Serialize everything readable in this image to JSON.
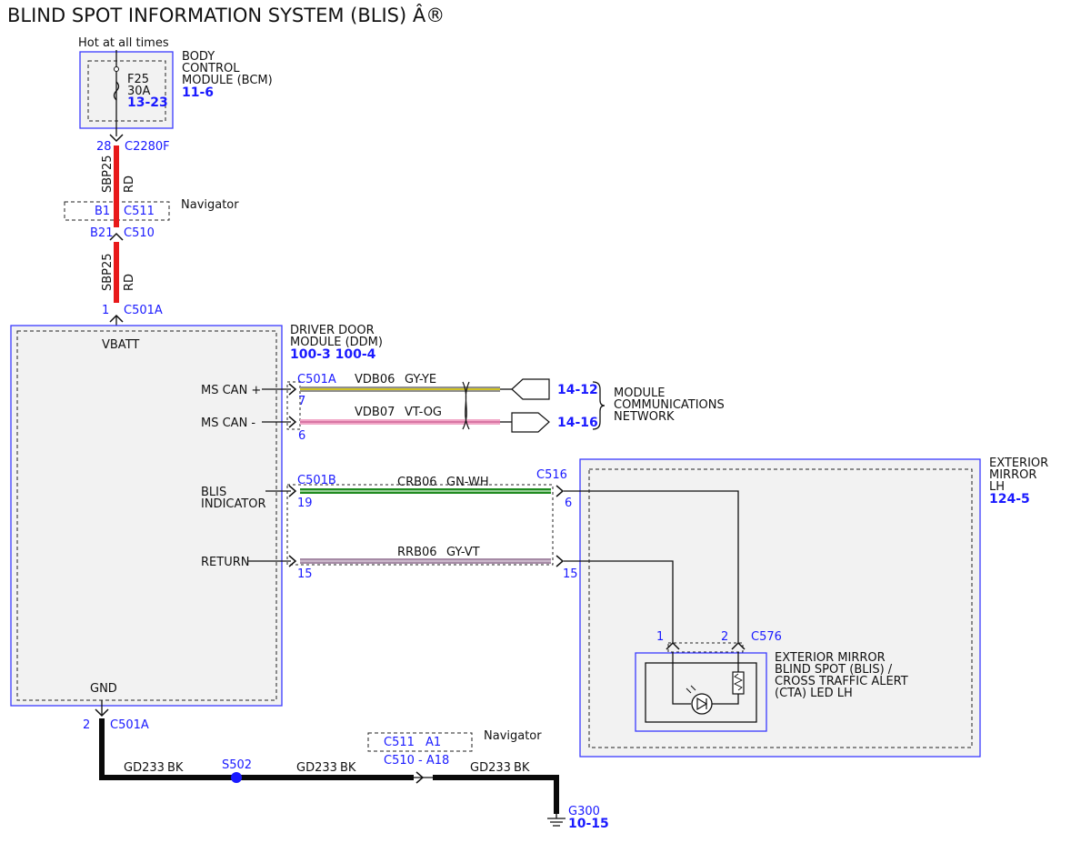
{
  "title": "BLIND SPOT INFORMATION SYSTEM (BLIS) Â®",
  "power": {
    "label": "Hot at all times"
  },
  "bcm": {
    "name_lines": [
      "BODY",
      "CONTROL",
      "MODULE (BCM)"
    ],
    "ref": "11-6",
    "fuse": {
      "id": "F25",
      "rating": "30A",
      "ref": "13-23"
    }
  },
  "conn_c2280f": {
    "pin": "28",
    "id": "C2280F"
  },
  "wire_sbp25": {
    "circuit": "SBP25",
    "color": "RD",
    "hex": "#e8191a"
  },
  "navigator_c511": {
    "left": "B1",
    "right": "C511",
    "label": "Navigator",
    "lower_pin": "B21",
    "lower_conn": "C510"
  },
  "conn_c501a_top": {
    "pin": "1",
    "id": "C501A"
  },
  "ddm": {
    "name_lines": [
      "DRIVER DOOR",
      "MODULE (DDM)"
    ],
    "ref": "100-3 100-4",
    "pins": {
      "vbatt": "VBATT",
      "ms_can_plus": "MS CAN +",
      "ms_can_minus": "MS CAN -",
      "blis_lines": [
        "BLIS",
        "INDICATOR"
      ],
      "return": "RETURN",
      "gnd": "GND"
    }
  },
  "can_plus": {
    "conn": "C501A",
    "pin": "7",
    "circuit": "VDB06",
    "color": "GY-YE",
    "ref": "14-12",
    "hex": "#8f8f8f",
    "stripe": "#e6d300"
  },
  "can_minus": {
    "pin": "6",
    "circuit": "VDB07",
    "color": "VT-OG",
    "ref": "14-16",
    "hex": "#f2a7c7",
    "stripe": "#c85a8f"
  },
  "mcn": {
    "lines": [
      "MODULE",
      "COMMUNICATIONS",
      "NETWORK"
    ]
  },
  "blis_wire": {
    "conn": "C501B",
    "pin": "19",
    "circuit": "CRB06",
    "color": "GN-WH",
    "hex": "#1f8a1f",
    "stripe": "#bfe6bf",
    "mirror_conn": "C516",
    "mirror_pin": "6"
  },
  "return_wire": {
    "pin": "15",
    "circuit": "RRB06",
    "color": "GY-VT",
    "hex": "#a58aa5",
    "stripe": "#d8c6d8",
    "mirror_pin": "15"
  },
  "mirror": {
    "name_lines": [
      "EXTERIOR",
      "MIRROR",
      "LH"
    ],
    "ref": "124-5",
    "c576": {
      "pin1": "1",
      "pin2": "2",
      "id": "C576"
    },
    "led_lines": [
      "EXTERIOR MIRROR",
      "BLIND SPOT (BLIS) /",
      "CROSS TRAFFIC ALERT",
      "(CTA) LED LH"
    ]
  },
  "ground": {
    "pin": "2",
    "conn": "C501A",
    "wire": "GD233",
    "color": "BK",
    "hex": "#0a0a0a",
    "splice": "S502",
    "nav_top": {
      "left": "C511",
      "right": "A1"
    },
    "nav_label": "Navigator",
    "nav_bottom": "C510 - A18",
    "g300": {
      "id": "G300",
      "ref": "10-15"
    }
  },
  "palette": {
    "box_border": "#3a3aff",
    "box_fill": "#f2f2f2",
    "link": "#1a1aff"
  }
}
